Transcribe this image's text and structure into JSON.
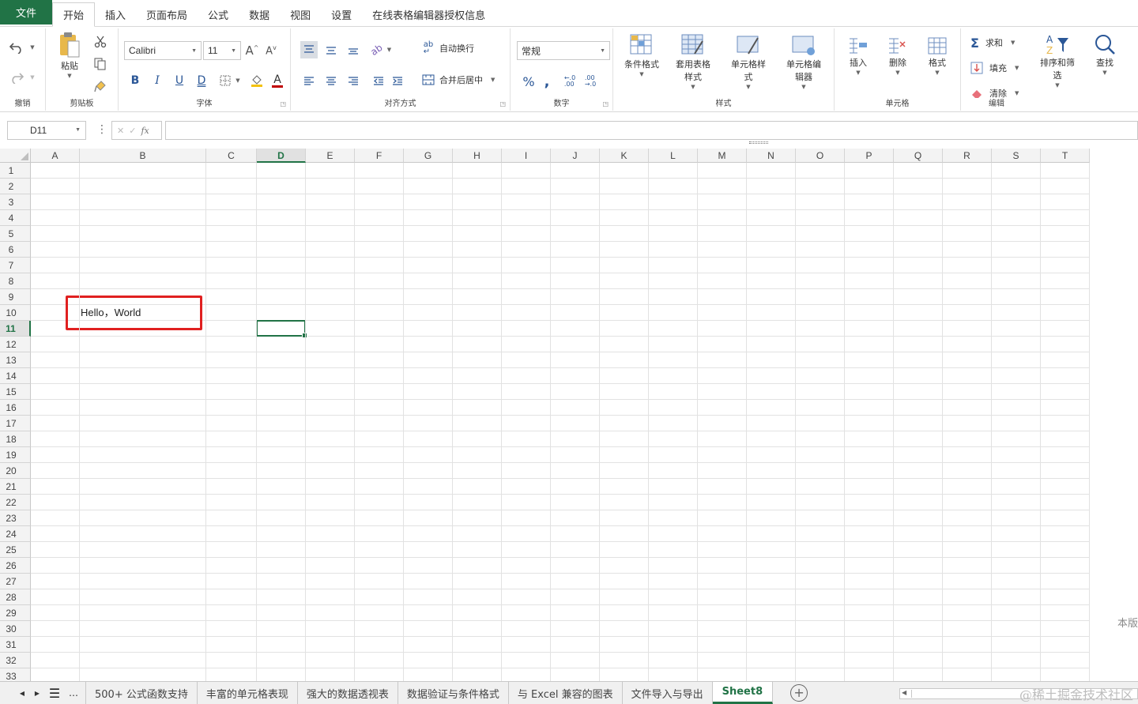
{
  "menu": {
    "file": "文件",
    "tabs": [
      "开始",
      "插入",
      "页面布局",
      "公式",
      "数据",
      "视图",
      "设置",
      "在线表格编辑器授权信息"
    ]
  },
  "ribbon": {
    "undo_group": "撤销",
    "clipboard": {
      "paste": "粘贴",
      "group": "剪贴板"
    },
    "font": {
      "name": "Calibri",
      "size": "11",
      "group": "字体"
    },
    "alignment": {
      "wrap": "自动换行",
      "merge": "合并后居中",
      "group": "对齐方式"
    },
    "number": {
      "format": "常规",
      "percent": "%",
      "comma": ",",
      "group": "数字"
    },
    "styles": {
      "conditional": [
        "条件格式"
      ],
      "table": [
        "套用表格",
        "样式"
      ],
      "cell_style": [
        "单元格样",
        "式"
      ],
      "cell_editor": [
        "单元格编",
        "辑器"
      ],
      "group": "样式"
    },
    "cells": {
      "insert": "插入",
      "delete": "删除",
      "format": "格式",
      "group": "单元格"
    },
    "editing": {
      "sum": "求和",
      "fill": "填充",
      "clear": "清除",
      "sort": [
        "排序和筛",
        "选"
      ],
      "find": "查找",
      "group": "编辑"
    }
  },
  "formula_bar": {
    "name_box": "D11",
    "fx": "fx",
    "value": ""
  },
  "columns": [
    "A",
    "B",
    "C",
    "D",
    "E",
    "F",
    "G",
    "H",
    "I",
    "J",
    "K",
    "L",
    "M",
    "N",
    "O",
    "P",
    "Q",
    "R",
    "S",
    "T"
  ],
  "rows": [
    "1",
    "2",
    "3",
    "4",
    "5",
    "6",
    "7",
    "8",
    "9",
    "10",
    "11",
    "12",
    "13",
    "14",
    "15",
    "16",
    "17",
    "18",
    "19",
    "20",
    "21",
    "22",
    "23",
    "24",
    "25",
    "26",
    "27",
    "28",
    "29",
    "30",
    "31",
    "32",
    "33"
  ],
  "selected": {
    "column": "D",
    "row": "11"
  },
  "cell_B10": "Hello，World",
  "side_note": "本版",
  "sheet_tabs": [
    "500+ 公式函数支持",
    "丰富的单元格表现",
    "强大的数据透视表",
    "数据验证与条件格式",
    "与 Excel 兼容的图表",
    "文件导入与导出",
    "Sheet8"
  ],
  "active_sheet": "Sheet8",
  "watermark": "@稀土掘金技术社区",
  "colors": {
    "accent": "#217346",
    "highlight_box": "#e02020"
  }
}
